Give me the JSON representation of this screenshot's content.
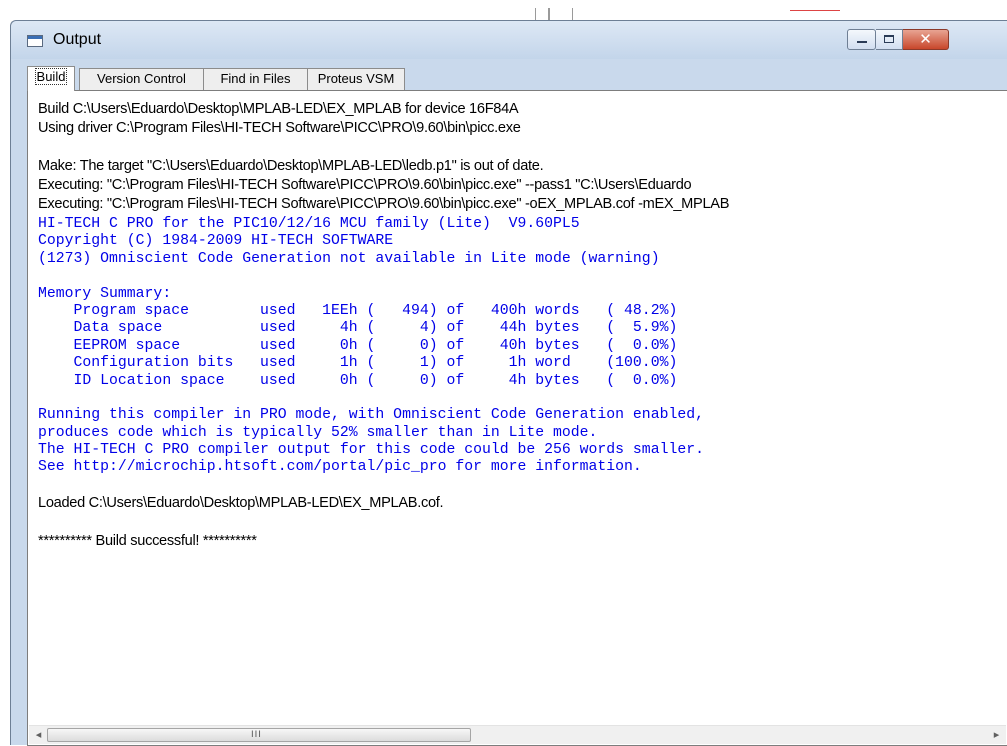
{
  "window": {
    "title": "Output",
    "icon": "output-window-icon",
    "controls": {
      "minimize": "minimize-icon",
      "maximize": "maximize-icon",
      "close": "close-icon",
      "close_glyph": "✕"
    }
  },
  "tabs": [
    {
      "label": "Build",
      "active": true
    },
    {
      "label": "Version Control",
      "active": false
    },
    {
      "label": "Find in Files",
      "active": false
    },
    {
      "label": "Proteus VSM",
      "active": false
    }
  ],
  "log": [
    {
      "text": "Build C:\\Users\\Eduardo\\Desktop\\MPLAB-LED\\EX_MPLAB for device 16F84A",
      "style": "sans"
    },
    {
      "text": "Using driver C:\\Program Files\\HI-TECH Software\\PICC\\PRO\\9.60\\bin\\picc.exe",
      "style": "sans"
    },
    {
      "text": "",
      "style": "sans"
    },
    {
      "text": "Make: The target \"C:\\Users\\Eduardo\\Desktop\\MPLAB-LED\\ledb.p1\" is out of date.",
      "style": "sans"
    },
    {
      "text": "Executing: \"C:\\Program Files\\HI-TECH Software\\PICC\\PRO\\9.60\\bin\\picc.exe\" --pass1 \"C:\\Users\\Eduardo",
      "style": "sans"
    },
    {
      "text": "Executing: \"C:\\Program Files\\HI-TECH Software\\PICC\\PRO\\9.60\\bin\\picc.exe\" -oEX_MPLAB.cof -mEX_MPLAB",
      "style": "sans"
    },
    {
      "text": "HI-TECH C PRO for the PIC10/12/16 MCU family (Lite)  V9.60PL5",
      "style": "mono"
    },
    {
      "text": "Copyright (C) 1984-2009 HI-TECH SOFTWARE",
      "style": "mono"
    },
    {
      "text": "(1273) Omniscient Code Generation not available in Lite mode (warning)",
      "style": "mono"
    },
    {
      "text": "",
      "style": "mono"
    },
    {
      "text": "Memory Summary:",
      "style": "mono"
    },
    {
      "text": "    Program space        used   1EEh (   494) of   400h words   ( 48.2%)",
      "style": "mono"
    },
    {
      "text": "    Data space           used     4h (     4) of    44h bytes   (  5.9%)",
      "style": "mono"
    },
    {
      "text": "    EEPROM space         used     0h (     0) of    40h bytes   (  0.0%)",
      "style": "mono"
    },
    {
      "text": "    Configuration bits   used     1h (     1) of     1h word    (100.0%)",
      "style": "mono"
    },
    {
      "text": "    ID Location space    used     0h (     0) of     4h bytes   (  0.0%)",
      "style": "mono"
    },
    {
      "text": "",
      "style": "mono"
    },
    {
      "text": "Running this compiler in PRO mode, with Omniscient Code Generation enabled,",
      "style": "mono"
    },
    {
      "text": "produces code which is typically 52% smaller than in Lite mode.",
      "style": "mono"
    },
    {
      "text": "The HI-TECH C PRO compiler output for this code could be 256 words smaller.",
      "style": "mono"
    },
    {
      "text": "See http://microchip.htsoft.com/portal/pic_pro for more information.",
      "style": "mono"
    },
    {
      "text": "",
      "style": "sans"
    },
    {
      "text": "Loaded C:\\Users\\Eduardo\\Desktop\\MPLAB-LED\\EX_MPLAB.cof.",
      "style": "sans"
    },
    {
      "text": "",
      "style": "sans"
    },
    {
      "text": "********** Build successful! **********",
      "style": "sans"
    }
  ],
  "scrollbar": {
    "left_arrow": "◂",
    "right_arrow": "▸",
    "grip": "III"
  },
  "colors": {
    "log_blue": "#0000e8",
    "title_gradient_top": "#dde8f5",
    "close_red": "#c8472b"
  }
}
